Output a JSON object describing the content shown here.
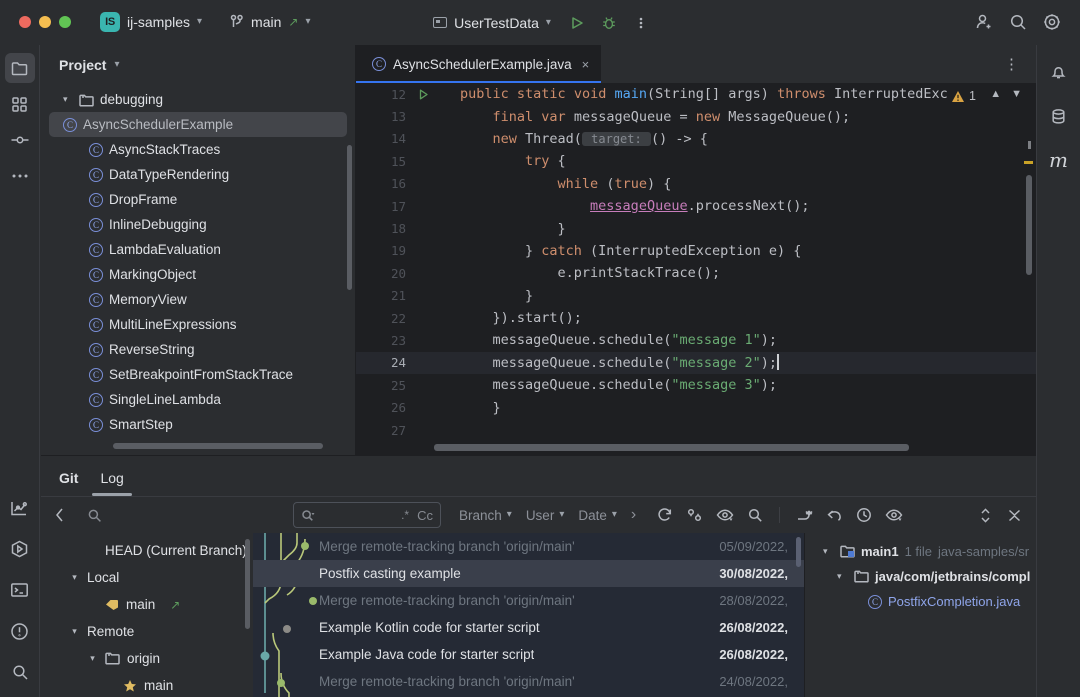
{
  "titlebar": {
    "project_badge": "IS",
    "project_name": "ij-samples",
    "branch_icon": "git-branch-icon",
    "branch_name": "main",
    "run_config": "UserTestData",
    "run_label": "run-button",
    "debug_label": "debug-button",
    "more_label": "more-actions-button",
    "account_label": "account-button",
    "search_label": "search-everywhere-button",
    "settings_label": "settings-button"
  },
  "left_strip": {
    "items": [
      {
        "name": "project-tool-window",
        "icon": "folder-icon",
        "active": true
      },
      {
        "name": "commit-tool-window",
        "icon": "commit-grid-icon",
        "active": false
      },
      {
        "name": "pull-requests-tool-window",
        "icon": "branch-node-icon",
        "active": false
      },
      {
        "name": "more-tool-windows",
        "icon": "ellipsis-icon",
        "active": false
      }
    ],
    "bottom_items": [
      {
        "name": "profiler-tool-window",
        "icon": "chart-icon"
      },
      {
        "name": "run-tool-window",
        "icon": "run-hex-icon"
      },
      {
        "name": "terminal-tool-window",
        "icon": "terminal-icon"
      },
      {
        "name": "problems-tool-window",
        "icon": "warning-circle-icon"
      },
      {
        "name": "search-tool-window",
        "icon": "search-icon"
      }
    ]
  },
  "right_strip": {
    "items": [
      {
        "name": "notifications-tool-window",
        "icon": "bell-icon"
      },
      {
        "name": "database-tool-window",
        "icon": "database-icon"
      },
      {
        "name": "maven-tool-window",
        "icon": "maven-m-icon"
      }
    ]
  },
  "project_panel": {
    "title": "Project",
    "chevron": "chevron-down-icon",
    "tree": [
      {
        "label": "debugging",
        "type": "folder",
        "indent": 1,
        "expanded": true,
        "selected": false
      },
      {
        "label": "AsyncSchedulerExample",
        "type": "class",
        "indent": 2,
        "selected": true
      },
      {
        "label": "AsyncStackTraces",
        "type": "class",
        "indent": 2,
        "selected": false
      },
      {
        "label": "DataTypeRendering",
        "type": "class",
        "indent": 2,
        "selected": false
      },
      {
        "label": "DropFrame",
        "type": "class",
        "indent": 2,
        "selected": false
      },
      {
        "label": "InlineDebugging",
        "type": "class",
        "indent": 2,
        "selected": false
      },
      {
        "label": "LambdaEvaluation",
        "type": "class",
        "indent": 2,
        "selected": false
      },
      {
        "label": "MarkingObject",
        "type": "class",
        "indent": 2,
        "selected": false
      },
      {
        "label": "MemoryView",
        "type": "class",
        "indent": 2,
        "selected": false
      },
      {
        "label": "MultiLineExpressions",
        "type": "class",
        "indent": 2,
        "selected": false
      },
      {
        "label": "ReverseString",
        "type": "class",
        "indent": 2,
        "selected": false
      },
      {
        "label": "SetBreakpointFromStackTrace",
        "type": "class",
        "indent": 2,
        "selected": false
      },
      {
        "label": "SingleLineLambda",
        "type": "class",
        "indent": 2,
        "selected": false
      },
      {
        "label": "SmartStep",
        "type": "class",
        "indent": 2,
        "selected": false
      }
    ]
  },
  "editor": {
    "tab_label": "AsyncSchedulerExample.java",
    "tab_icon": "java-class-icon",
    "tab_close": "×",
    "more_icon": "vertical-ellipsis-icon",
    "warning_count": "1",
    "warning_icon": "warning-triangle-icon",
    "prev_icon": "chevron-up-icon",
    "next_icon": "chevron-down-icon",
    "current_line": 24,
    "lines": [
      {
        "no": "12",
        "gutter": "run-gutter-icon"
      },
      {
        "no": "13",
        "gutter": ""
      },
      {
        "no": "14",
        "gutter": ""
      },
      {
        "no": "15",
        "gutter": ""
      },
      {
        "no": "16",
        "gutter": ""
      },
      {
        "no": "17",
        "gutter": ""
      },
      {
        "no": "18",
        "gutter": ""
      },
      {
        "no": "19",
        "gutter": ""
      },
      {
        "no": "20",
        "gutter": ""
      },
      {
        "no": "21",
        "gutter": ""
      },
      {
        "no": "22",
        "gutter": ""
      },
      {
        "no": "23",
        "gutter": ""
      },
      {
        "no": "24",
        "gutter": ""
      },
      {
        "no": "25",
        "gutter": ""
      },
      {
        "no": "26",
        "gutter": ""
      },
      {
        "no": "27",
        "gutter": ""
      }
    ],
    "code_text": [
      "public static void main(String[] args) throws InterruptedExc",
      "    final var messageQueue = new MessageQueue();",
      "    new Thread( target: () -> {",
      "        try {",
      "            while (true) {",
      "                messageQueue.processNext();",
      "            }",
      "        } catch (InterruptedException e) {",
      "            e.printStackTrace();",
      "        }",
      "    }).start();",
      "    messageQueue.schedule(\"message 1\");",
      "    messageQueue.schedule(\"message 2\");",
      "    messageQueue.schedule(\"message 3\");",
      "}",
      ""
    ]
  },
  "git_panel": {
    "tabs": [
      {
        "label": "Git",
        "bold": true,
        "selected": false
      },
      {
        "label": "Log",
        "bold": false,
        "selected": true
      }
    ],
    "collapse_icon": "chevron-left-icon",
    "branch_search_placeholder": "",
    "branch_search_icon": "search-icon",
    "log_search_icon": "search-dropdown-icon",
    "log_search_value": "",
    "log_regex_label": ".*",
    "log_case_label": "Cc",
    "filters": [
      {
        "label": "Branch",
        "name": "branch-filter"
      },
      {
        "label": "User",
        "name": "user-filter"
      },
      {
        "label": "Date",
        "name": "date-filter"
      }
    ],
    "filter_more": "›",
    "toolbar_icons": [
      {
        "name": "refresh-icon"
      },
      {
        "name": "compare-revisions-icon"
      },
      {
        "name": "show-hide-icon"
      },
      {
        "name": "find-icon"
      }
    ],
    "toolbar_icons2": [
      {
        "name": "cherry-pick-icon"
      },
      {
        "name": "revert-icon"
      },
      {
        "name": "history-icon"
      },
      {
        "name": "preview-diff-icon"
      }
    ],
    "toolbar_right": [
      {
        "name": "expand-collapse-icon"
      },
      {
        "name": "hide-panel-icon"
      }
    ],
    "branches": [
      {
        "label": "HEAD (Current Branch)",
        "indent": 2,
        "icon": "",
        "arrow": ""
      },
      {
        "label": "Local",
        "indent": 1,
        "icon": "",
        "arrow": "⌄"
      },
      {
        "label": "main",
        "indent": 2,
        "icon": "tag-icon",
        "arrow": "",
        "badge": "↗"
      },
      {
        "label": "Remote",
        "indent": 1,
        "icon": "",
        "arrow": "⌄"
      },
      {
        "label": "origin",
        "indent": 2,
        "icon": "folder-icon",
        "arrow": "⌄"
      },
      {
        "label": "main",
        "indent": 3,
        "icon": "star-icon",
        "arrow": ""
      }
    ],
    "commits": [
      {
        "message": "Merge remote-tracking branch 'origin/main'",
        "date": "05/09/2022,",
        "dim": true,
        "selected": false
      },
      {
        "message": "Postfix casting example",
        "date": "30/08/2022,",
        "dim": false,
        "selected": true
      },
      {
        "message": "Merge remote-tracking branch 'origin/main'",
        "date": "28/08/2022,",
        "dim": true,
        "selected": false
      },
      {
        "message": "Example Kotlin code for starter script",
        "date": "26/08/2022,",
        "dim": false,
        "selected": false
      },
      {
        "message": "Example Java code for starter script",
        "date": "26/08/2022,",
        "dim": false,
        "selected": false
      },
      {
        "message": "Merge remote-tracking branch 'origin/main'",
        "date": "24/08/2022,",
        "dim": true,
        "selected": false
      }
    ],
    "details": [
      {
        "label": "main1",
        "meta": "1 file",
        "path": "java-samples/sr",
        "indent": 1,
        "icon": "module-icon",
        "arrow": "⌄"
      },
      {
        "label": "java/com/jetbrains/compl",
        "meta": "",
        "path": "",
        "indent": 2,
        "icon": "folder-icon",
        "arrow": "⌄"
      },
      {
        "label": "PostfixCompletion.java",
        "meta": "",
        "path": "",
        "indent": 3,
        "icon": "java-class-icon",
        "arrow": ""
      }
    ]
  },
  "colors": {
    "accent_blue": "#3574f0",
    "bg_dark": "#1e1f22",
    "bg_panel": "#2b2d30",
    "bg_log": "#252a35",
    "selection": "#43454a",
    "green_run": "#5d9c5d",
    "keyword": "#cf8e6d",
    "string": "#6aab73",
    "method": "#56a8f5"
  }
}
